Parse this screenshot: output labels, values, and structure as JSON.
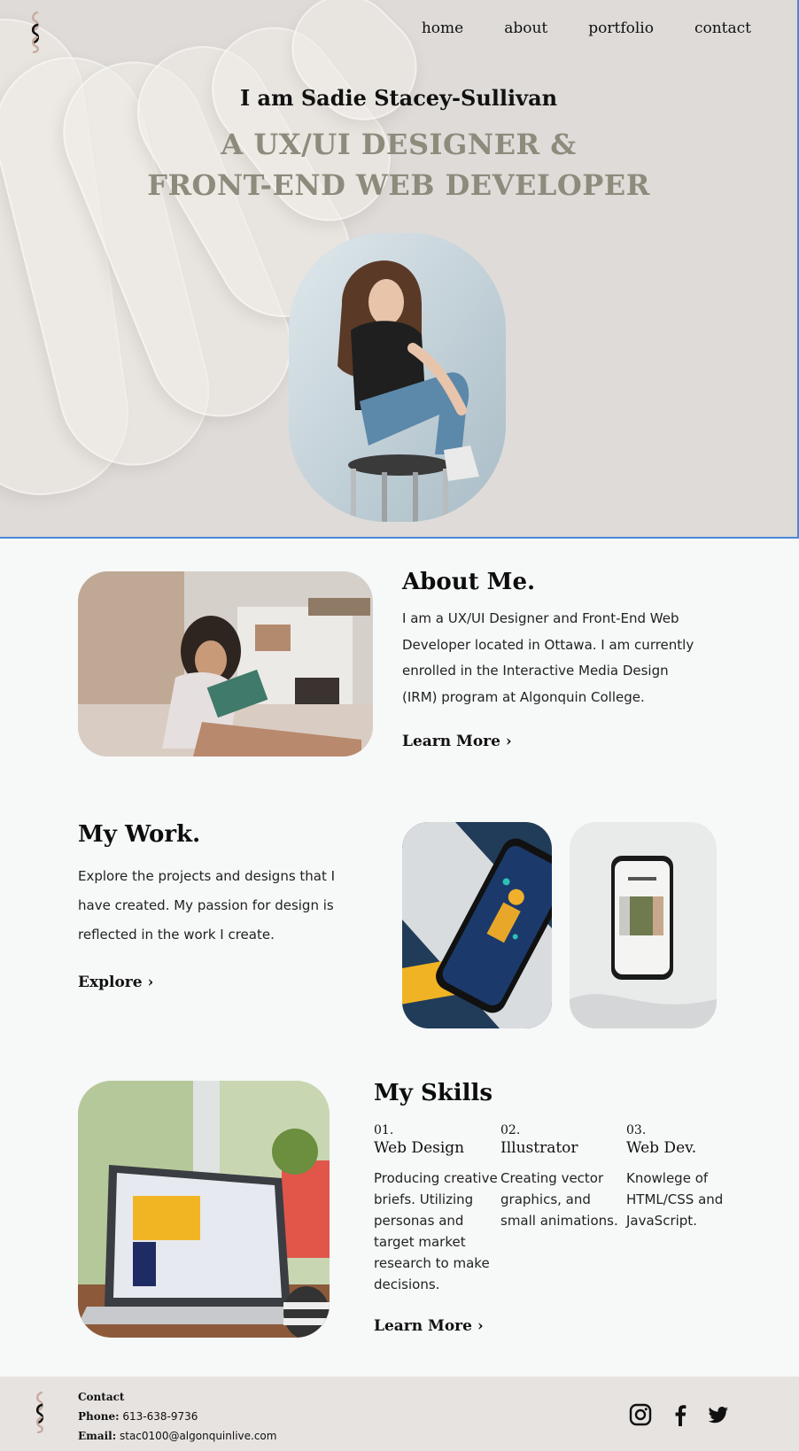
{
  "nav": {
    "items": [
      {
        "label": "home"
      },
      {
        "label": "about"
      },
      {
        "label": "portfolio"
      },
      {
        "label": "contact"
      }
    ]
  },
  "hero": {
    "intro": "I am Sadie Stacey-Sullivan",
    "role_line1": "A UX/UI DESIGNER &",
    "role_line2": "FRONT-END WEB DEVELOPER"
  },
  "about": {
    "title": "About Me.",
    "text": "I am a UX/UI Designer and Front-End Web Developer located in Ottawa.  I am currently enrolled in the Interactive Media Design (IRM) program at Algonquin College.",
    "link": "Learn More ›"
  },
  "work": {
    "title": "My Work.",
    "text": "Explore the projects and designs that I have created. My passion for design is reflected in the work I create.",
    "link": "Explore ›"
  },
  "skills": {
    "title": "My Skills",
    "items": [
      {
        "num": "01.",
        "name": "Web Design",
        "desc": "Producing creative briefs. Utilizing personas and target market research to make decisions."
      },
      {
        "num": "02.",
        "name": "Illustrator",
        "desc": "Creating vector graphics, and small animations."
      },
      {
        "num": "03.",
        "name": "Web Dev.",
        "desc": "Knowlege of HTML/CSS and JavaScript."
      }
    ],
    "link": "Learn More ›"
  },
  "footer": {
    "heading": "Contact",
    "phone_label": "Phone:",
    "phone": "613-638-9736",
    "email_label": "Email:",
    "email": "stac0100@algonquinlive.com"
  },
  "social": [
    "instagram-icon",
    "facebook-icon",
    "twitter-icon"
  ],
  "colors": {
    "hero_bg": "#dedbd8",
    "accent_text": "#8e8a7c",
    "logo": "#c9aba0",
    "border": "#4a88da"
  }
}
